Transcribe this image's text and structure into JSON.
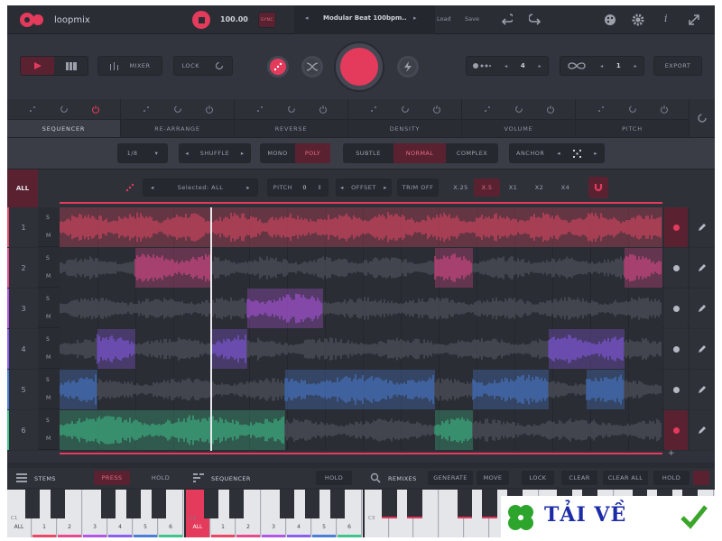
{
  "header": {
    "brand": "loopmix",
    "bpm": "100.00",
    "sync": "SYNC",
    "project": "Modular Beat 100bpm..",
    "load": "Load",
    "save": "Save"
  },
  "transport": {
    "mixer": "MIXER",
    "lock": "LOCK",
    "bars": "4",
    "loops": "1",
    "export": "EXPORT"
  },
  "tabs": [
    "SEQUENCER",
    "RE-ARRANGE",
    "REVERSE",
    "DENSITY",
    "VOLUME",
    "PITCH"
  ],
  "options": {
    "division": "1/8",
    "shuffle": "SHUFFLE",
    "mono": "MONO",
    "poly": "POLY",
    "subtle": "SUBTLE",
    "normal": "NORMAL",
    "complex": "COMPLEX",
    "anchor": "ANCHOR"
  },
  "toolbar": {
    "all": "ALL",
    "selected": "Selected: ALL",
    "pitch": "PITCH",
    "pitch_value": "0",
    "offset": "OFFSET",
    "trim": "TRIM OFF",
    "speeds": [
      "X.25",
      "X.5",
      "X1",
      "X2",
      "X4"
    ],
    "active_speed": "X.5"
  },
  "tracks": [
    {
      "num": "1",
      "s": "S",
      "m": "M",
      "color": "#e84866"
    },
    {
      "num": "2",
      "s": "S",
      "m": "M",
      "color": "#e84a8f"
    },
    {
      "num": "3",
      "s": "S",
      "m": "M",
      "color": "#b456e6"
    },
    {
      "num": "4",
      "s": "S",
      "m": "M",
      "color": "#8a5ef0"
    },
    {
      "num": "5",
      "s": "S",
      "m": "M",
      "color": "#4a7ed8"
    },
    {
      "num": "6",
      "s": "S",
      "m": "M",
      "color": "#3ec48c"
    }
  ],
  "bottom": {
    "stems": "STEMS",
    "stems_mode": "PRESS",
    "stems_hold": "HOLD",
    "sequencer": "SEQUENCER",
    "seq_hold": "HOLD",
    "remixes": "REMIXES",
    "generate": "GENERATE",
    "move": "MOVE",
    "lock": "LOCK",
    "clear": "CLEAR",
    "clear_all": "CLEAR ALL",
    "remix_hold": "HOLD",
    "octave_left": "C1",
    "octave_mid": "C2",
    "octave_right": "C3",
    "all": "ALL",
    "keys": [
      "1",
      "2",
      "3",
      "4",
      "5",
      "6"
    ]
  },
  "watermark": {
    "text": "TẢI VỀ"
  }
}
